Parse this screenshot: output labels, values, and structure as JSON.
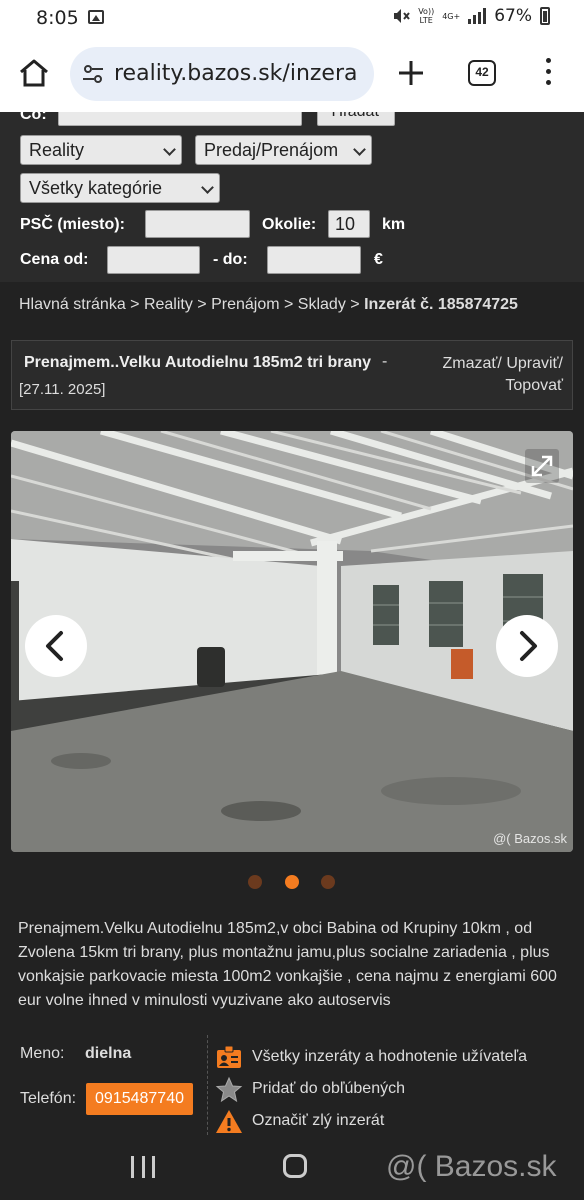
{
  "status_bar": {
    "time": "8:05",
    "net_labels": [
      "Vo))",
      "LTE"
    ],
    "net_type": "4G+",
    "battery": "67%"
  },
  "browser": {
    "url": "reality.bazos.sk/inzera",
    "tab_count": "42"
  },
  "search": {
    "co_label": "Čo:",
    "search_button": "Hľadať",
    "section_select": "Reality",
    "type_select": "Predaj/Prenájom",
    "category_select": "Všetky kategórie",
    "psc_label": "PSČ  (miesto):",
    "psc_value": "",
    "okolie_label": "Okolie:",
    "okolie_value": "10",
    "okolie_unit": "km",
    "cena_label": "Cena  od:",
    "cena_sep": "-  do:",
    "cena_unit": "€"
  },
  "breadcrumb": {
    "path": "Hlavná stránka > Reality > Prenájom > Sklady > ",
    "current": "Inzerát č. 185874725"
  },
  "listing": {
    "title": "Prenajmem..Velku Autodielnu 185m2 tri brany",
    "title_sep": "-",
    "date": "[27.11. 2025]",
    "actions_line1": "Zmazať/ Upraviť/",
    "actions_line2": "Topovať",
    "watermark": "@( Bazos.sk",
    "photo_count": 3,
    "active_photo_index": 1,
    "description": "Prenajmem.Velku Autodielnu 185m2,v obci Babina od Krupiny 10km , od Zvolena 15km tri brany, plus montažnu jamu,plus socialne zariadenia , plus vonkajsie parkovacie miesta 100m2 vonkajšie , cena najmu z energiami 600 eur volne ihned v minulosti vyuzivane ako autoservis"
  },
  "contact": {
    "name_label": "Meno:",
    "name_value": "dielna",
    "phone_label": "Telefón:",
    "phone_value": "0915487740",
    "links": [
      {
        "label": "Všetky inzeráty a hodnotenie užívateľa",
        "icon": "user-card-icon"
      },
      {
        "label": "Pridať do obľúbených",
        "icon": "star-icon"
      },
      {
        "label": "Označiť zlý inzerát",
        "icon": "warning-icon"
      }
    ]
  },
  "nav_watermark": "@( Bazos.sk",
  "colors": {
    "background": "#222222",
    "accent_orange": "#f47c20",
    "dot_inactive": "#6b3a1e"
  }
}
